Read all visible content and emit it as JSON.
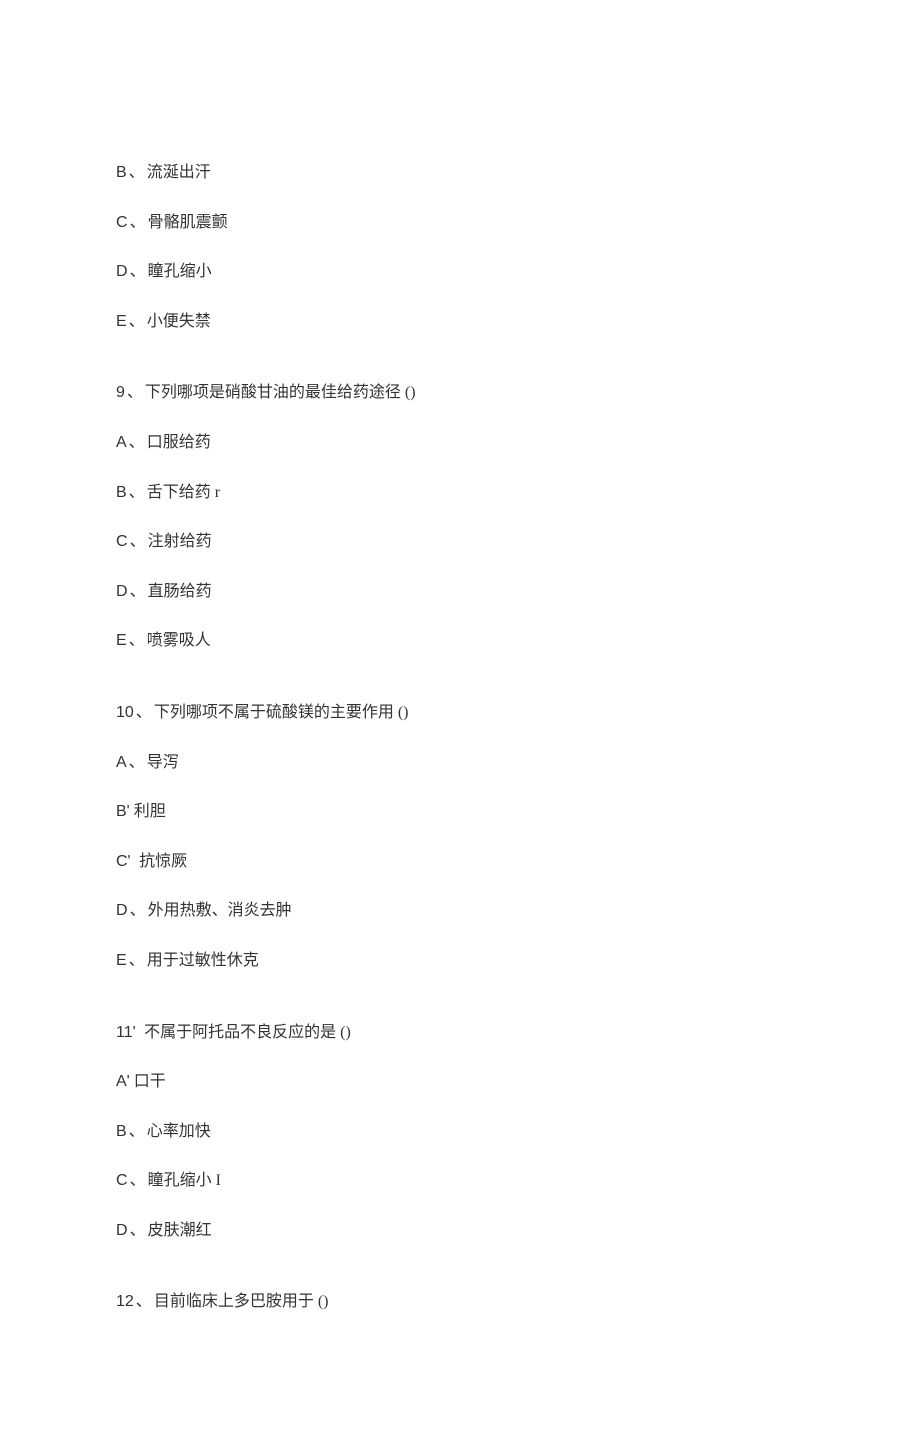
{
  "items": [
    {
      "kind": "option",
      "letter": "B",
      "sep": "、",
      "text": "流涎出汗"
    },
    {
      "kind": "option",
      "letter": "C",
      "sep": "、",
      "text": "骨骼肌震颤"
    },
    {
      "kind": "option",
      "letter": "D",
      "sep": "、",
      "text": "瞳孔缩小"
    },
    {
      "kind": "option",
      "letter": "E",
      "sep": "、",
      "text": "小便失禁"
    },
    {
      "kind": "question",
      "num": "9",
      "sep": "、",
      "text": "下列哪项是硝酸甘油的最佳给药途径 ()",
      "cls": "first"
    },
    {
      "kind": "option",
      "letter": "A",
      "sep": "、",
      "text": "口服给药"
    },
    {
      "kind": "option",
      "letter": "B",
      "sep": "、",
      "text": "舌下给药 r"
    },
    {
      "kind": "option",
      "letter": "C",
      "sep": "、",
      "text": "注射给药"
    },
    {
      "kind": "option",
      "letter": "D",
      "sep": "、",
      "text": "直肠给药"
    },
    {
      "kind": "option",
      "letter": "E",
      "sep": "、",
      "text": "喷雾吸人"
    },
    {
      "kind": "question",
      "num": "10",
      "sep": "、",
      "text": "下列哪项不属于硫酸镁的主要作用 ()",
      "cls": ""
    },
    {
      "kind": "option",
      "letter": "A",
      "sep": "、",
      "text": "导泻"
    },
    {
      "kind": "option",
      "letter": "B'",
      "sep": "",
      "text": "利胆"
    },
    {
      "kind": "option",
      "letter": "C'",
      "sep": " ",
      "text": "抗惊厥"
    },
    {
      "kind": "option",
      "letter": "D",
      "sep": "、",
      "text": "外用热敷、消炎去肿"
    },
    {
      "kind": "option",
      "letter": "E",
      "sep": "、",
      "text": "用于过敏性休克"
    },
    {
      "kind": "question",
      "num": "11'",
      "sep": " ",
      "text": "不属于阿托品不良反应的是 ()",
      "cls": ""
    },
    {
      "kind": "option",
      "letter": "A'",
      "sep": "",
      "text": "口干"
    },
    {
      "kind": "option",
      "letter": "B",
      "sep": "、",
      "text": "心率加快"
    },
    {
      "kind": "option",
      "letter": "C",
      "sep": "、",
      "text": "瞳孔缩小 I"
    },
    {
      "kind": "option",
      "letter": "D",
      "sep": "、",
      "text": "皮肤潮红"
    },
    {
      "kind": "question",
      "num": "12",
      "sep": "、",
      "text": "目前临床上多巴胺用于 ()",
      "cls": "lastq"
    }
  ]
}
